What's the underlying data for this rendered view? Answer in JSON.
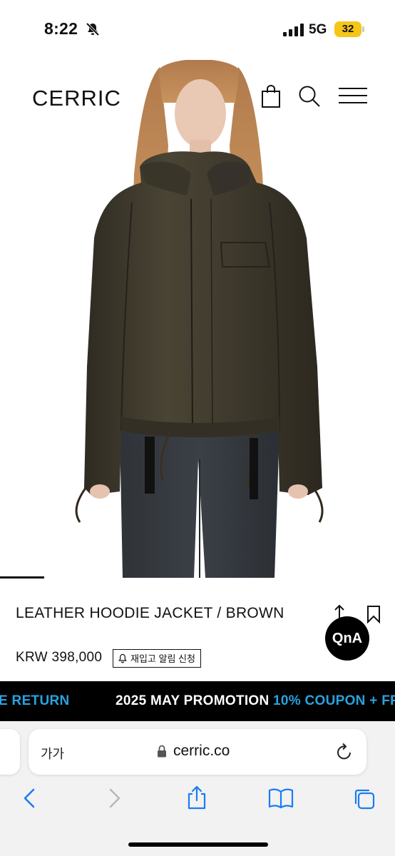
{
  "status_bar": {
    "time": "8:22",
    "network": "5G",
    "battery": "32"
  },
  "header": {
    "logo": "CERRIC"
  },
  "product": {
    "name": "LEATHER HOODIE JACKET / BROWN",
    "price": "KRW 398,000",
    "restock_label": "재입고 알림 신청",
    "qna_label": "QnA"
  },
  "promo": {
    "lead": "E RETURN",
    "main": "2025 MAY PROMOTION",
    "accent": "10% COUPON + FR"
  },
  "browser": {
    "text_size_label": "가가",
    "url": "cerric.co"
  },
  "colors": {
    "promo_accent": "#29a3e0",
    "battery": "#f5c518",
    "safari_blue": "#1a7cf2"
  }
}
